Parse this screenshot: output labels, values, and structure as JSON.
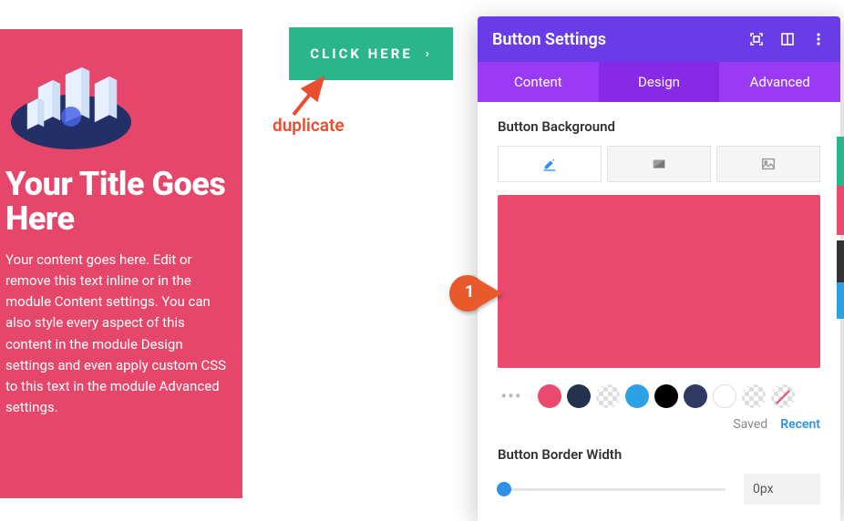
{
  "card": {
    "title": "Your Title Goes Here",
    "body": "Your content goes here. Edit or remove this text inline or in the module Content settings. You can also style every aspect of this content in the module Design settings and even apply custom CSS to this text in the module Advanced settings."
  },
  "cta_button": {
    "label": "CLICK HERE"
  },
  "annotation": {
    "duplicate": "duplicate",
    "step1": "1"
  },
  "panel": {
    "title": "Button Settings",
    "tabs": {
      "content": "Content",
      "design": "Design",
      "advanced": "Advanced"
    },
    "sections": {
      "background_label": "Button Background",
      "border_width_label": "Button Border Width"
    },
    "preview_color": "#e94a6e",
    "swatches": [
      "#e94a6e",
      "#23324f",
      "checker",
      "#2ea0e6",
      "#000000",
      "#2e3a63",
      "outline",
      "checker",
      "checker-strike"
    ],
    "saved_label": "Saved",
    "recent_label": "Recent",
    "border_width_value": "0px"
  }
}
